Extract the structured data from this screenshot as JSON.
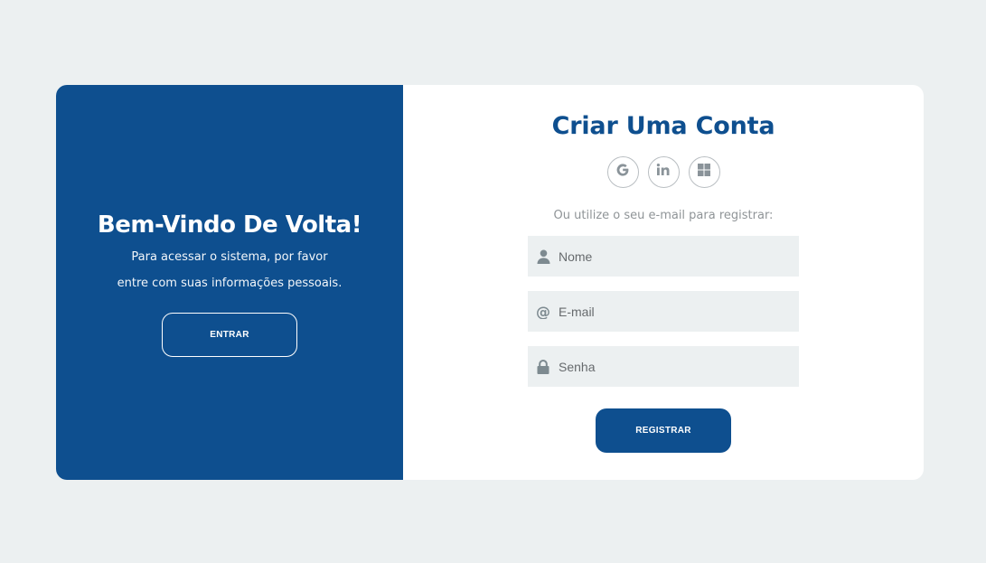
{
  "welcome": {
    "title": "Bem-Vindo De Volta!",
    "line1": "Para acessar o sistema, por favor",
    "line2": "entre com suas informações pessoais.",
    "button": "ENTRAR"
  },
  "register": {
    "title": "Criar Uma Conta",
    "social": [
      {
        "icon": "google-icon"
      },
      {
        "icon": "linkedin-icon"
      },
      {
        "icon": "microsoft-icon"
      }
    ],
    "hint": "Ou utilize o seu e-mail para registrar:",
    "fields": {
      "name": {
        "placeholder": "Nome",
        "icon": "user-icon"
      },
      "email": {
        "placeholder": "E-mail",
        "icon": "at-icon"
      },
      "password": {
        "placeholder": "Senha",
        "icon": "lock-icon"
      }
    },
    "button": "REGISTRAR"
  },
  "colors": {
    "brand": "#0e4f8f",
    "background": "#ecf0f1",
    "icon": "#7d8a90"
  }
}
